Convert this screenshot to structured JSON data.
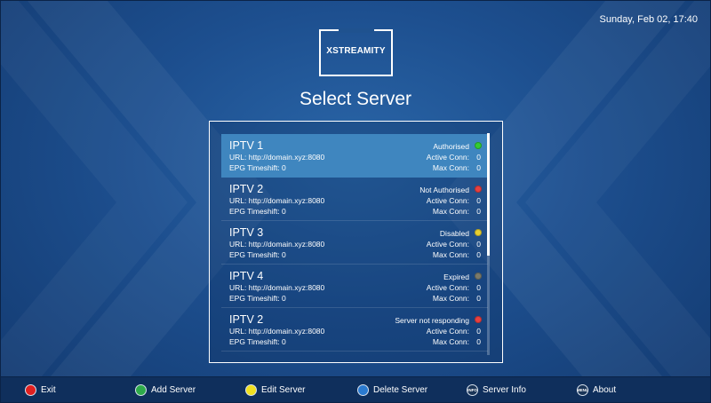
{
  "header": {
    "datetime": "Sunday, Feb 02, 17:40"
  },
  "logo": {
    "text": "XSTREAMITY"
  },
  "title": "Select Server",
  "servers": [
    {
      "name": "IPTV 1",
      "url": "URL: http://domain.xyz:8080",
      "epg": "EPG Timeshift: 0",
      "status": "Authorised",
      "status_color": "#33cc33",
      "active_label": "Active Conn:",
      "active_value": "0",
      "max_label": "Max Conn:",
      "max_value": "0",
      "selected": true
    },
    {
      "name": "IPTV 2",
      "url": "URL: http://domain.xyz:8080",
      "epg": "EPG Timeshift: 0",
      "status": "Not Authorised",
      "status_color": "#e84040",
      "active_label": "Active Conn:",
      "active_value": "0",
      "max_label": "Max Conn:",
      "max_value": "0",
      "selected": false
    },
    {
      "name": "IPTV 3",
      "url": "URL: http://domain.xyz:8080",
      "epg": "EPG Timeshift: 0",
      "status": "Disabled",
      "status_color": "#e8d030",
      "active_label": "Active Conn:",
      "active_value": "0",
      "max_label": "Max Conn:",
      "max_value": "0",
      "selected": false
    },
    {
      "name": "IPTV 4",
      "url": "URL: http://domain.xyz:8080",
      "epg": "EPG Timeshift: 0",
      "status": "Expired",
      "status_color": "#7a7a6a",
      "active_label": "Active Conn:",
      "active_value": "0",
      "max_label": "Max Conn:",
      "max_value": "0",
      "selected": false
    },
    {
      "name": "IPTV 2",
      "url": "URL: http://domain.xyz:8080",
      "epg": "EPG Timeshift: 0",
      "status": "Server not responding",
      "status_color": "#e84040",
      "active_label": "Active Conn:",
      "active_value": "0",
      "max_label": "Max Conn:",
      "max_value": "0",
      "selected": false
    }
  ],
  "footer": {
    "exit": {
      "label": "Exit",
      "color": "#e02020",
      "icon": "red-button-icon"
    },
    "add": {
      "label": "Add Server",
      "color": "#2eaa4a",
      "icon": "green-button-icon"
    },
    "edit": {
      "label": "Edit Server",
      "color": "#f0e020",
      "icon": "yellow-button-icon"
    },
    "delete": {
      "label": "Delete Server",
      "color": "#2a7ad0",
      "icon": "blue-button-icon"
    },
    "info": {
      "label": "Server Info",
      "key": "INFO",
      "icon": "info-button-icon"
    },
    "about": {
      "label": "About",
      "key": "MENU",
      "icon": "menu-button-icon"
    }
  }
}
